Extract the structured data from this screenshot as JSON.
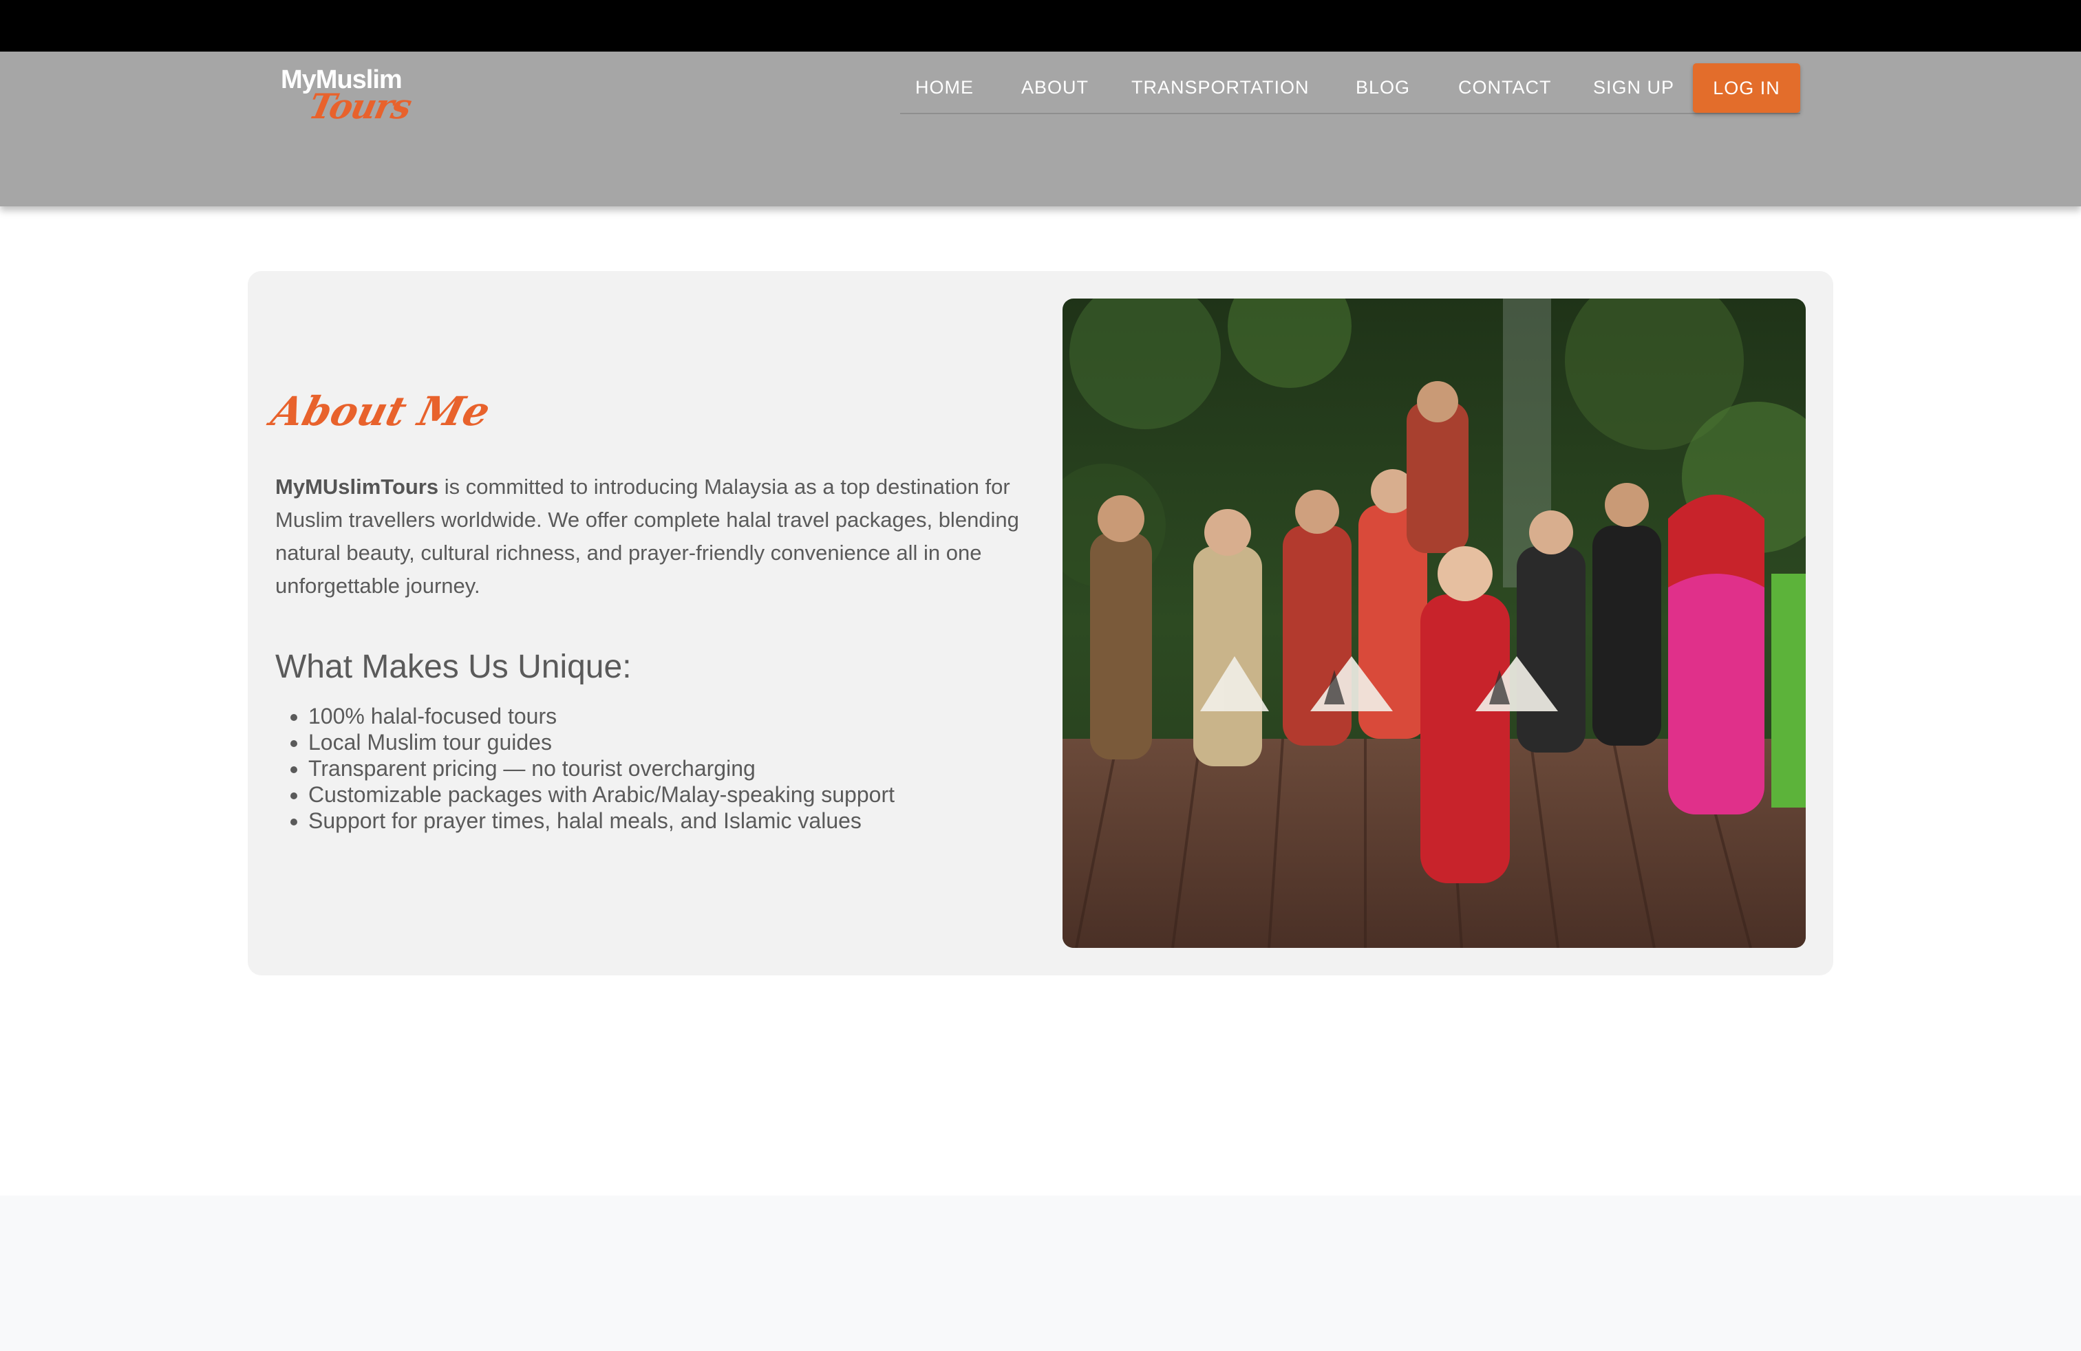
{
  "brand": {
    "logo_top": "MyMuslim",
    "logo_bottom": "Tours",
    "accent_color": "#e36d2b"
  },
  "nav": {
    "items": [
      "HOME",
      "ABOUT",
      "TRANSPORTATION",
      "BLOG",
      "CONTACT",
      "SIGN UP"
    ],
    "login": "LOG IN"
  },
  "about": {
    "title": "About Me",
    "brand_name": "MyMUslimTours",
    "description": " is committed to introducing Malaysia as a top destination for Muslim travellers worldwide. We offer complete halal travel packages, blending natural beauty, cultural richness, and prayer-friendly convenience all in one unforgettable journey."
  },
  "unique": {
    "title": "What Makes Us Unique:",
    "items": [
      "100% halal-focused tours",
      "Local Muslim tour guides",
      "Transparent pricing — no tourist overcharging",
      "Customizable packages with Arabic/Malay-speaking support",
      "Support for prayer times, halal meals, and Islamic values"
    ]
  },
  "image": {
    "icon": "photo-cultural-dancers"
  }
}
